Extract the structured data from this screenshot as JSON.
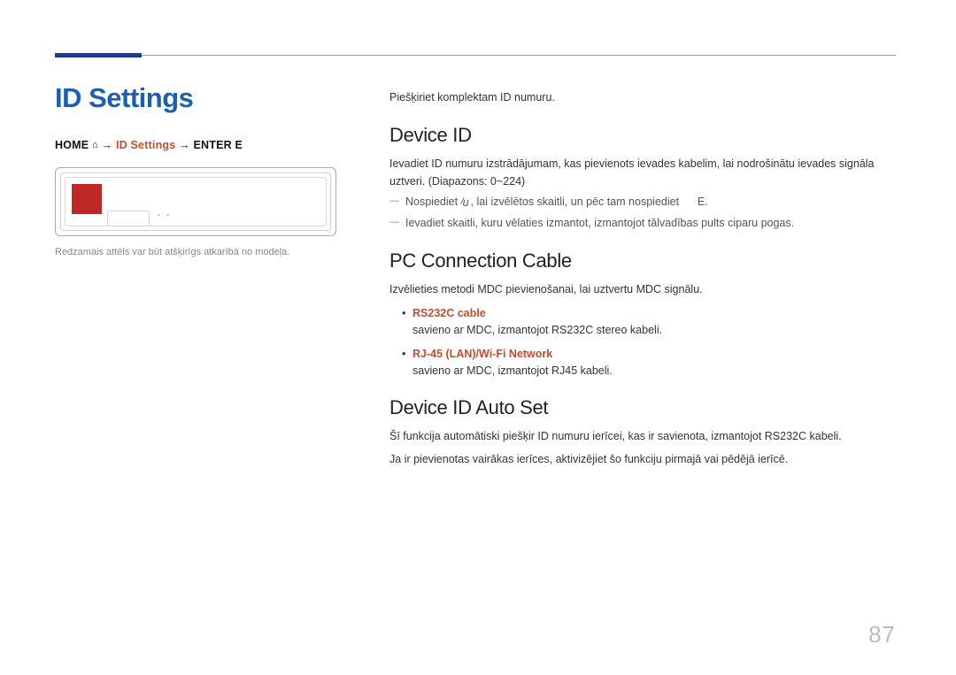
{
  "page_title": "ID Settings",
  "breadcrumb": {
    "home": "HOME",
    "arrow": "→",
    "current": "ID Settings",
    "enter": "ENTER E"
  },
  "caption": "Redzamais attēls var būt atšķirīgs atkarībā no modeļa.",
  "intro": "Piešķiriet komplektam ID numuru.",
  "sections": {
    "device_id": {
      "heading": "Device ID",
      "body": "Ievadiet ID numuru izstrādājumam, kas pievienots ievades kabelim, lai nodrošinātu ievades signāla uztveri. (Diapazons: 0~224)",
      "sub1_a": "Nospiediet",
      "sub1_b": ", lai izvēlētos skaitli, un pēc tam nospiediet",
      "sub1_c": "E.",
      "sub2": "Ievadiet skaitli, kuru vēlaties izmantot, izmantojot tālvadības pults ciparu pogas."
    },
    "pc_cable": {
      "heading": "PC Connection Cable",
      "body": "Izvēlieties metodi MDC pievienošanai, lai uztvertu MDC signālu.",
      "opts": [
        {
          "name": "RS232C cable",
          "desc": "savieno ar MDC, izmantojot RS232C stereo kabeli."
        },
        {
          "name": "RJ-45 (LAN)/Wi-Fi Network",
          "desc": "savieno ar MDC, izmantojot RJ45 kabeli."
        }
      ]
    },
    "auto_set": {
      "heading": "Device ID Auto Set",
      "body1": "Šī funkcija automātiski piešķir ID numuru ierīcei, kas ir savienota, izmantojot RS232C kabeli.",
      "body2": "Ja ir pievienotas vairākas ierīces, aktivizējiet šo funkciju pirmajā vai pēdējā ierīcē."
    }
  },
  "page_number": "87"
}
